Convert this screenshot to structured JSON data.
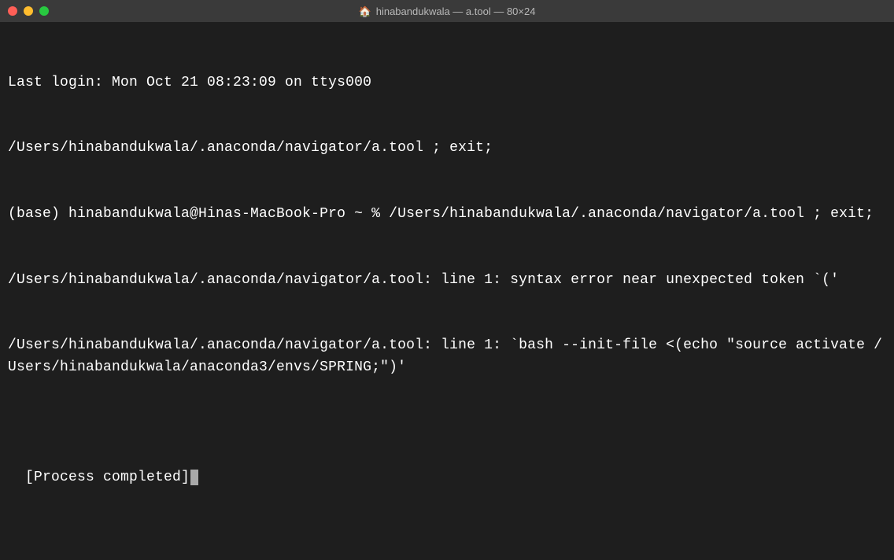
{
  "window": {
    "title": "hinabandukwala — a.tool — 80×24",
    "traffic_lights": {
      "close": "close",
      "minimize": "minimize",
      "maximize": "maximize"
    },
    "home_icon": "🏠"
  },
  "terminal": {
    "lines": {
      "l0": "Last login: Mon Oct 21 08:23:09 on ttys000",
      "l1": "/Users/hinabandukwala/.anaconda/navigator/a.tool ; exit;",
      "l2": "(base) hinabandukwala@Hinas-MacBook-Pro ~ % /Users/hinabandukwala/.anaconda/navigator/a.tool ; exit;",
      "l3": "/Users/hinabandukwala/.anaconda/navigator/a.tool: line 1: syntax error near unexpected token `('",
      "l4": "/Users/hinabandukwala/.anaconda/navigator/a.tool: line 1: `bash --init-file <(echo \"source activate /Users/hinabandukwala/anaconda3/envs/SPRING;\")'",
      "l5": "",
      "l6": "[Process completed]"
    }
  }
}
